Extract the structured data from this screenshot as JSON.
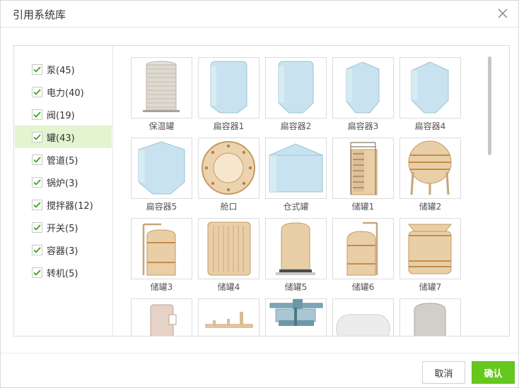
{
  "dialog": {
    "title": "引用系统库",
    "close_icon": "close-icon"
  },
  "categories": [
    {
      "label": "泵(45)",
      "checked": true,
      "active": false
    },
    {
      "label": "电力(40)",
      "checked": true,
      "active": false
    },
    {
      "label": "阀(19)",
      "checked": true,
      "active": false
    },
    {
      "label": "罐(43)",
      "checked": true,
      "active": true
    },
    {
      "label": "管道(5)",
      "checked": true,
      "active": false
    },
    {
      "label": "锅炉(3)",
      "checked": true,
      "active": false
    },
    {
      "label": "搅拌器(12)",
      "checked": true,
      "active": false
    },
    {
      "label": "开关(5)",
      "checked": true,
      "active": false
    },
    {
      "label": "容器(3)",
      "checked": true,
      "active": false
    },
    {
      "label": "转机(5)",
      "checked": true,
      "active": false
    }
  ],
  "items": [
    {
      "label": "保温罐",
      "icon": "insulated-tank-icon"
    },
    {
      "label": "扁容器1",
      "icon": "flat-vessel-icon"
    },
    {
      "label": "扁容器2",
      "icon": "flat-vessel-icon"
    },
    {
      "label": "扁容器3",
      "icon": "flat-vessel-icon"
    },
    {
      "label": "扁容器4",
      "icon": "flat-vessel-icon"
    },
    {
      "label": "扁容器5",
      "icon": "flat-vessel-icon"
    },
    {
      "label": "舱口",
      "icon": "hatch-icon"
    },
    {
      "label": "仓式罐",
      "icon": "silo-tank-icon"
    },
    {
      "label": "储罐1",
      "icon": "storage-tank-icon"
    },
    {
      "label": "储罐2",
      "icon": "spherical-tank-icon"
    },
    {
      "label": "储罐3",
      "icon": "storage-tank-icon"
    },
    {
      "label": "储罐4",
      "icon": "storage-tank-icon"
    },
    {
      "label": "储罐5",
      "icon": "storage-tank-icon"
    },
    {
      "label": "储罐6",
      "icon": "storage-tank-icon"
    },
    {
      "label": "储罐7",
      "icon": "storage-tank-icon"
    },
    {
      "label": "",
      "icon": "tank-icon"
    },
    {
      "label": "",
      "icon": "pipe-fitting-icon"
    },
    {
      "label": "",
      "icon": "mixer-tank-icon"
    },
    {
      "label": "",
      "icon": "horizontal-tank-icon"
    },
    {
      "label": "",
      "icon": "tank-icon"
    }
  ],
  "footer": {
    "cancel_label": "取消",
    "ok_label": "确认"
  },
  "colors": {
    "accent": "#66c71f",
    "active_row": "#e3f4d1",
    "check": "#3aa51a",
    "vessel_blue": "#c8e3ef",
    "tank_beige": "#e9cfa8",
    "band_orange": "#d69a4c"
  }
}
